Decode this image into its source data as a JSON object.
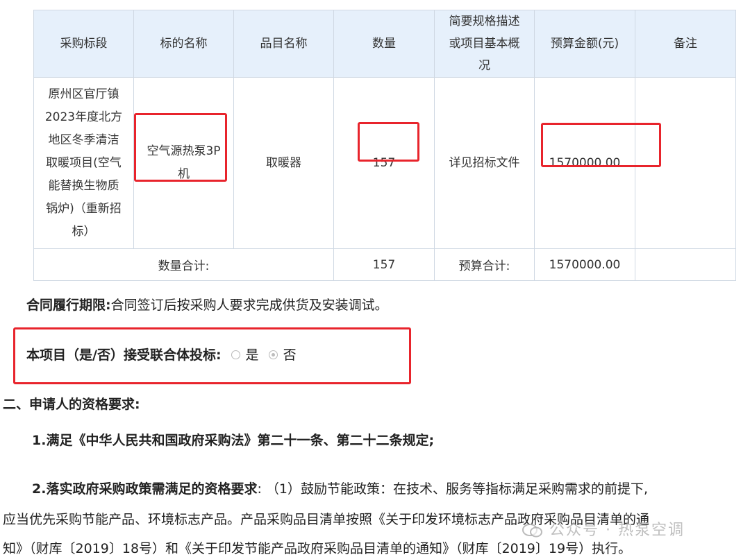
{
  "table": {
    "headers": [
      "采购标段",
      "标的名称",
      "品目名称",
      "数量",
      "简要规格描述或项目基本概况",
      "预算金额(元)",
      "备注"
    ],
    "row": {
      "segment": "原州区官厅镇2023年度北方地区冬季清洁取暖项目(空气能替换生物质锅炉)（重新招标）",
      "subject": "空气源热泵3P机",
      "category": "取暖器",
      "quantity": "157",
      "spec": "详见招标文件",
      "budget": "1570000.00",
      "remark": ""
    },
    "totals": {
      "qty_label": "数量合计:",
      "qty_value": "157",
      "budget_label": "预算合计:",
      "budget_value": "1570000.00"
    }
  },
  "contract": {
    "label": "合同履行期限:",
    "text": "合同签订后按采购人要求完成供货及安装调试。"
  },
  "consortium": {
    "label": "本项目（是/否）接受联合体投标:",
    "options": [
      "是",
      "否"
    ],
    "selected": "否"
  },
  "section2": {
    "heading": "二、申请人的资格要求:",
    "item1": "1.满足《中华人民共和国政府采购法》第二十一条、第二十二条规定;",
    "item2_bold": "2.落实政府采购政策需满足的资格要求",
    "item2_line1": ": （1）鼓励节能政策：在技术、服务等指标满足采购需求的前提下,",
    "item2_line2": "应当优先采购节能产品、环境标志产品。产品采购品目清单按照《关于印发环境标志产品政府采购品目清单的通",
    "item2_line3": "知》（财库〔2019〕18号）和《关于印发节能产品政府采购品目清单的通知》（财库〔2019〕19号）执行。"
  },
  "watermark": "公众号 · 热泵空调",
  "colors": {
    "highlight_box": "#e8242c",
    "header_bg": "#e6f0fb",
    "border": "#cfd8e3"
  }
}
